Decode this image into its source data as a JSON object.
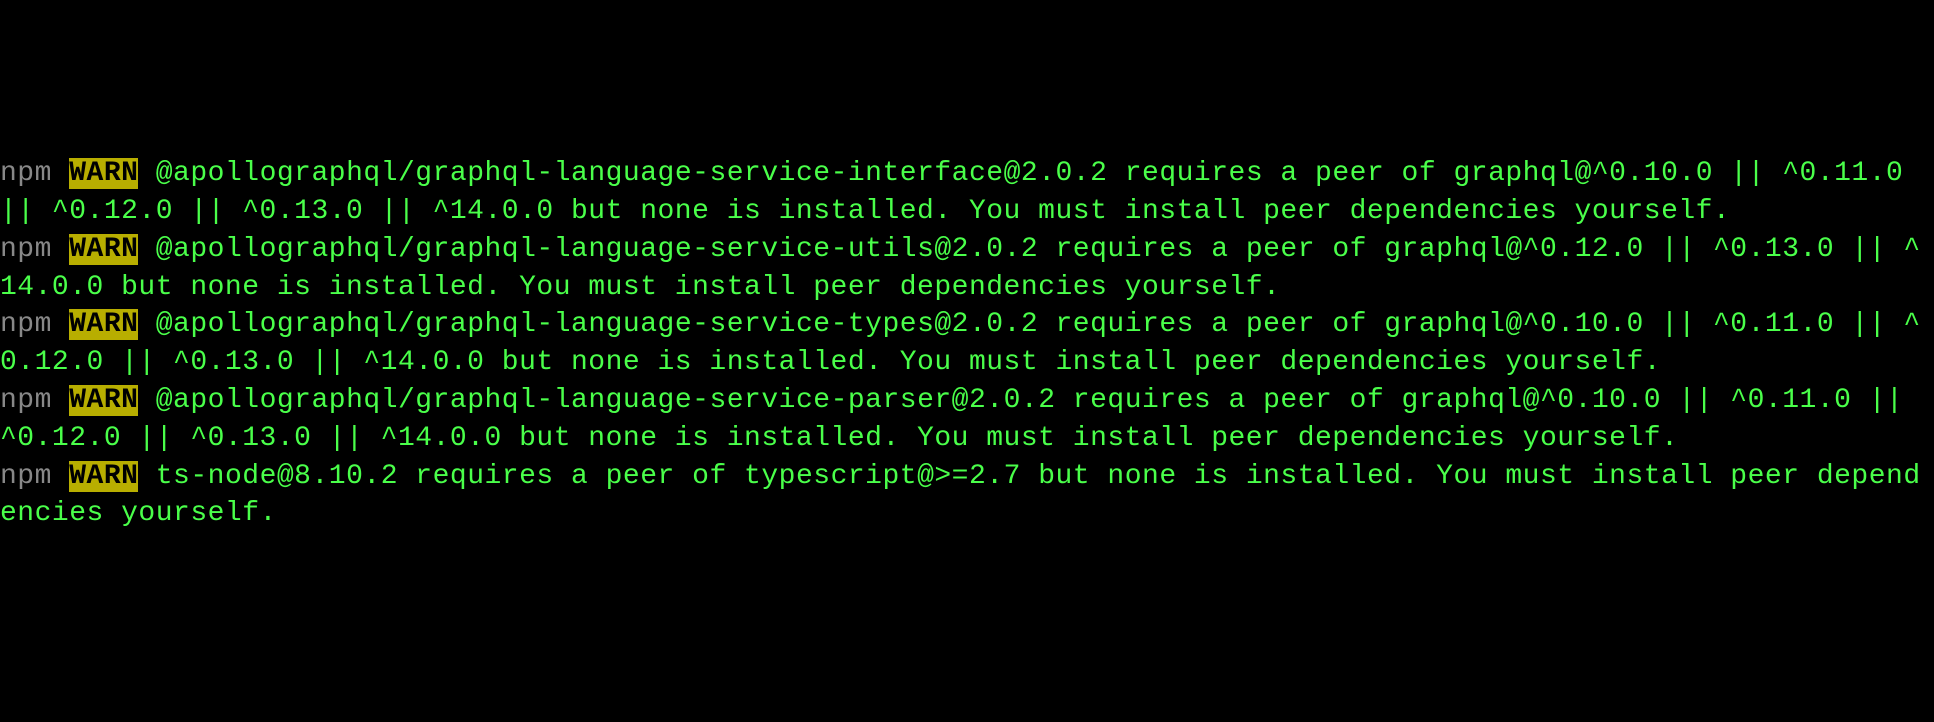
{
  "terminal": {
    "prefix": "npm",
    "warn_label": "WARN",
    "entries": [
      {
        "message": " @apollographql/graphql-language-service-interface@2.0.2 requires a peer of graphql@^0.10.0 || ^0.11.0 || ^0.12.0 || ^0.13.0 || ^14.0.0 but none is installed. You must install peer dependencies yourself."
      },
      {
        "message": " @apollographql/graphql-language-service-utils@2.0.2 requires a peer of graphql@^0.12.0 || ^0.13.0 || ^14.0.0 but none is installed. You must install peer dependencies yourself."
      },
      {
        "message": " @apollographql/graphql-language-service-types@2.0.2 requires a peer of graphql@^0.10.0 || ^0.11.0 || ^0.12.0 || ^0.13.0 || ^14.0.0 but none is installed. You must install peer dependencies yourself."
      },
      {
        "message": " @apollographql/graphql-language-service-parser@2.0.2 requires a peer of graphql@^0.10.0 || ^0.11.0 || ^0.12.0 || ^0.13.0 || ^14.0.0 but none is installed. You must install peer dependencies yourself."
      },
      {
        "message": " ts-node@8.10.2 requires a peer of typescript@>=2.7 but none is installed. You must install peer dependencies yourself."
      }
    ]
  }
}
